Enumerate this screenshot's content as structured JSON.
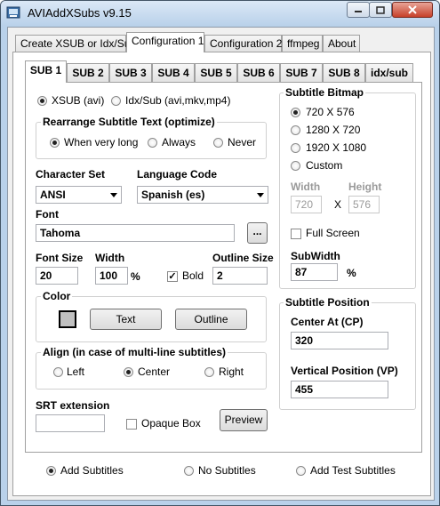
{
  "window": {
    "title": "AVIAddXSubs v9.15"
  },
  "top_tabs": [
    {
      "label": "Create XSUB or Idx/Sub"
    },
    {
      "label": "Configuration 1"
    },
    {
      "label": "Configuration 2"
    },
    {
      "label": "ffmpeg"
    },
    {
      "label": "About"
    }
  ],
  "sub_tabs": [
    {
      "label": "SUB 1"
    },
    {
      "label": "SUB 2"
    },
    {
      "label": "SUB 3"
    },
    {
      "label": "SUB 4"
    },
    {
      "label": "SUB 5"
    },
    {
      "label": "SUB 6"
    },
    {
      "label": "SUB 7"
    },
    {
      "label": "SUB 8"
    },
    {
      "label": "idx/sub"
    }
  ],
  "format": {
    "xsub_label": "XSUB (avi)",
    "idxsub_label": "Idx/Sub (avi,mkv,mp4)"
  },
  "rearrange": {
    "title": "Rearrange Subtitle Text (optimize)",
    "very_long": "When very long",
    "always": "Always",
    "never": "Never"
  },
  "charset": {
    "label": "Character Set",
    "value": "ANSI"
  },
  "language": {
    "label": "Language Code",
    "value": "Spanish (es)"
  },
  "font": {
    "label": "Font",
    "value": "Tahoma",
    "browse": "..."
  },
  "font_size": {
    "label": "Font Size",
    "value": "20"
  },
  "width": {
    "label": "Width",
    "value": "100",
    "unit": "%"
  },
  "bold": {
    "label": "Bold",
    "mark": "✓"
  },
  "outline_size": {
    "label": "Outline Size",
    "value": "2"
  },
  "color": {
    "title": "Color",
    "text_btn": "Text",
    "outline_btn": "Outline"
  },
  "align": {
    "title": "Align (in case of multi-line subtitles)",
    "left": "Left",
    "center": "Center",
    "right": "Right"
  },
  "srt": {
    "label": "SRT extension",
    "value": ""
  },
  "opaque": {
    "label": "Opaque Box"
  },
  "preview": {
    "label": "Preview"
  },
  "bitmap": {
    "title": "Subtitle Bitmap",
    "options": [
      "720 X 576",
      "1280 X 720",
      "1920 X 1080",
      "Custom"
    ],
    "width_label": "Width",
    "height_label": "Height",
    "width_value": "720",
    "x": "X",
    "height_value": "576",
    "fullscreen": "Full Screen",
    "subwidth_label": "SubWidth",
    "subwidth_value": "87",
    "subwidth_unit": "%"
  },
  "position": {
    "title": "Subtitle Position",
    "center_label": "Center At (CP)",
    "center_value": "320",
    "vertical_label": "Vertical Position (VP)",
    "vertical_value": "455"
  },
  "bottom": {
    "add": "Add Subtitles",
    "none": "No Subtitles",
    "test": "Add Test Subtitles"
  },
  "colors": {
    "title_bar": "#b9d1ea",
    "close": "#c7402a"
  }
}
